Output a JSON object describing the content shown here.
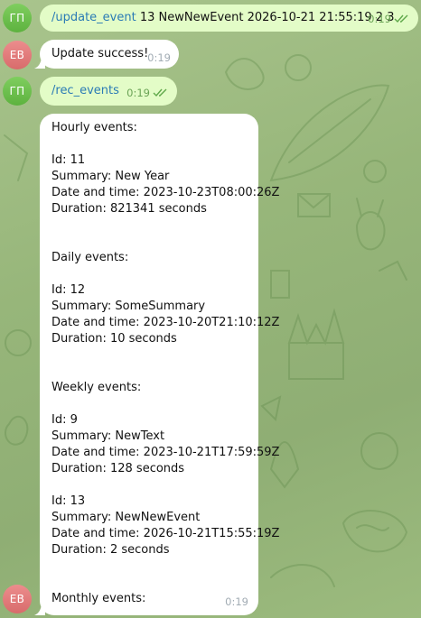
{
  "messages": [
    {
      "sender_initials": "ГП",
      "command": "/update_event",
      "text": " 13 NewNewEvent 2026-10-21 21:55:19 2 3",
      "time": "0:19"
    },
    {
      "sender_initials": "ЕВ",
      "text": "Update success!",
      "time": "0:19"
    },
    {
      "sender_initials": "ГП",
      "command": "/rec_events",
      "time": "0:19"
    },
    {
      "sender_initials": "ЕВ",
      "time": "0:19",
      "lines": [
        "Hourly events:",
        "",
        "Id: 11",
        "Summary: New Year",
        "Date and time: 2023-10-23T08:00:26Z",
        "Duration: 821341 seconds",
        "",
        "",
        "Daily events:",
        "",
        "Id: 12",
        "Summary: SomeSummary",
        "Date and time: 2023-10-20T21:10:12Z",
        "Duration: 10 seconds",
        "",
        "",
        "Weekly events:",
        "",
        "Id: 9",
        "Summary: NewText",
        "Date and time: 2023-10-21T17:59:59Z",
        "Duration: 128 seconds",
        "",
        "Id: 13",
        "Summary: NewNewEvent",
        "Date and time: 2026-10-21T15:55:19Z",
        "Duration: 2 seconds",
        "",
        "",
        "Monthly events:"
      ]
    }
  ],
  "icons": {
    "read_status": "double-check-icon"
  },
  "colors": {
    "outgoing_bubble": "#e3fcc7",
    "incoming_bubble": "#ffffff",
    "command_link": "#2a7bb5",
    "avatar_green": "#6cc04a",
    "avatar_red": "#e07a7a"
  }
}
